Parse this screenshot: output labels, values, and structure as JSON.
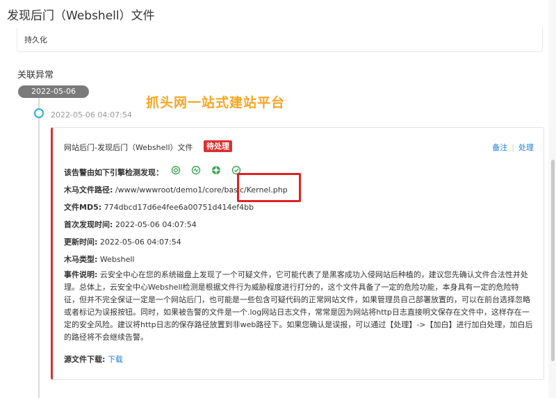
{
  "page_title": "发现后门（Webshell）文件",
  "persist_label": "持久化",
  "related_section_title": "关联异常",
  "timeline": {
    "date": "2022-05-06",
    "event_time": "2022-05-06 04:07:54"
  },
  "watermark": "抓头网一站式建站平台",
  "alert": {
    "title": "网站后门-发现后门（Webshell）文件",
    "status_badge": "待处理",
    "actions": {
      "note": "备注",
      "handle": "处理"
    },
    "engines_label": "该告警由如下引擎检测发现：",
    "engine_icons": [
      "engine-icon-1",
      "engine-icon-2",
      "engine-icon-3",
      "engine-icon-4"
    ],
    "fields": [
      {
        "label": "木马文件路径:",
        "value": "/www/wwwroot/demo1/core/basic/Kernel.php"
      },
      {
        "label": "文件MD5:",
        "value": "774dbcd17d6e4fee6a00751d414ef4bb"
      },
      {
        "label": "首次发现时间:",
        "value": "2022-05-06 04:07:54"
      },
      {
        "label": "更新时间:",
        "value": "2022-05-06 04:07:54"
      },
      {
        "label": "木马类型:",
        "value": "Webshell"
      }
    ],
    "description_label": "事件说明:",
    "description": "云安全中心在您的系统磁盘上发现了一个可疑文件，它可能代表了是黑客成功入侵网站后种植的，建议您先确认文件合法性并处理。总体上，云安全中心Webshell检测是根据文件行为威胁程度进行打分的，这个文件具备了一定的危险功能，本身具有一定的危险特征，但并不完全保证一定是一个网站后门，也可能是一些包含可疑代码的正常网站文件，如果管理员自己部署放置的，可以在前台选择忽略或者标记为误报按钮。同时，如果被告警的文件是一个.log网站日志文件，常常是因为网站将http日志直接明文保存在文件中，这样存在一定的安全风险。建议将http日志的保存路径放置到非web路径下。如果您确认是误报，可以通过【处理】->【加白】进行加白处理，加白后的路径将不会继续告警。",
    "source_download_label": "源文件下载:",
    "download_link": "下载"
  },
  "colors": {
    "accent_red": "#d9312f",
    "link_blue": "#1f7bd6",
    "timeline_cyan": "#26b0d4",
    "watermark_orange": "#f5a623"
  }
}
